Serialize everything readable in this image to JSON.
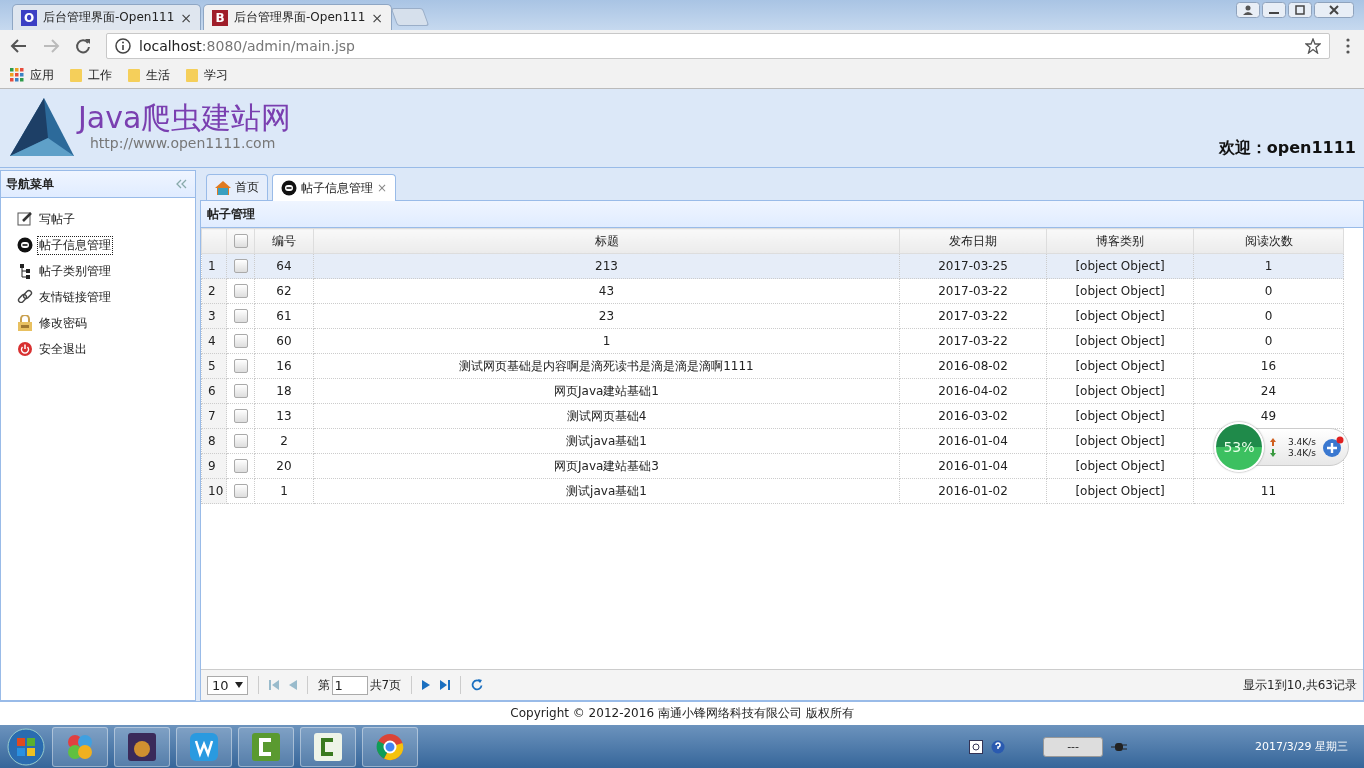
{
  "browser": {
    "tabs": [
      {
        "favicon": "O",
        "color": "#3b3fc4",
        "title": "后台管理界面-Open111",
        "close": "×",
        "selected": false
      },
      {
        "favicon": "B",
        "color": "#a01e2a",
        "title": "后台管理界面-Open111",
        "close": "×",
        "selected": true
      }
    ],
    "address": {
      "host": "localhost",
      "path": ":8080/admin/main.jsp"
    },
    "bookmarks": [
      {
        "kind": "apps",
        "label": "应用"
      },
      {
        "kind": "folder",
        "label": "工作"
      },
      {
        "kind": "folder",
        "label": "生活"
      },
      {
        "kind": "folder",
        "label": "学习"
      }
    ]
  },
  "header": {
    "logo_title": "Java爬虫建站网",
    "logo_url": "http://www.open1111.com",
    "welcome": "欢迎：open1111"
  },
  "sidebar": {
    "title": "导航菜单",
    "items": [
      {
        "kind": "edit",
        "label": "写帖子",
        "selected": false
      },
      {
        "kind": "blog",
        "label": "帖子信息管理",
        "selected": true
      },
      {
        "kind": "tree",
        "label": "帖子类别管理",
        "selected": false
      },
      {
        "kind": "link",
        "label": "友情链接管理",
        "selected": false
      },
      {
        "kind": "lock",
        "label": "修改密码",
        "selected": false
      },
      {
        "kind": "exit",
        "label": "安全退出",
        "selected": false
      }
    ]
  },
  "content_tabs": [
    {
      "kind": "home",
      "label": "首页",
      "selected": false,
      "closable": false
    },
    {
      "kind": "blog",
      "label": "帖子信息管理",
      "selected": true,
      "closable": true,
      "close": "×"
    }
  ],
  "panel": {
    "title": "帖子管理",
    "select_all_checked": false,
    "columns": [
      "编号",
      "标题",
      "发布日期",
      "博客类别",
      "阅读次数"
    ],
    "rows": [
      {
        "index": "1",
        "checked": false,
        "selected": true,
        "id": "64",
        "title": "213",
        "date": "2017-03-25",
        "category": "[object Object]",
        "reads": "1"
      },
      {
        "index": "2",
        "checked": false,
        "selected": false,
        "id": "62",
        "title": "43",
        "date": "2017-03-22",
        "category": "[object Object]",
        "reads": "0"
      },
      {
        "index": "3",
        "checked": false,
        "selected": false,
        "id": "61",
        "title": "23",
        "date": "2017-03-22",
        "category": "[object Object]",
        "reads": "0"
      },
      {
        "index": "4",
        "checked": false,
        "selected": false,
        "id": "60",
        "title": "1",
        "date": "2017-03-22",
        "category": "[object Object]",
        "reads": "0"
      },
      {
        "index": "5",
        "checked": false,
        "selected": false,
        "id": "16",
        "title": "测试网页基础是内容啊是滴死读书是滴是滴是滴啊1111",
        "date": "2016-08-02",
        "category": "[object Object]",
        "reads": "16"
      },
      {
        "index": "6",
        "checked": false,
        "selected": false,
        "id": "18",
        "title": "网页Java建站基础1",
        "date": "2016-04-02",
        "category": "[object Object]",
        "reads": "24"
      },
      {
        "index": "7",
        "checked": false,
        "selected": false,
        "id": "13",
        "title": "测试网页基础4",
        "date": "2016-03-02",
        "category": "[object Object]",
        "reads": "49"
      },
      {
        "index": "8",
        "checked": false,
        "selected": false,
        "id": "2",
        "title": "测试java基础1",
        "date": "2016-01-04",
        "category": "[object Object]"
      },
      {
        "index": "9",
        "checked": false,
        "selected": false,
        "id": "20",
        "title": "网页Java建站基础3",
        "date": "2016-01-04",
        "category": "[object Object]"
      },
      {
        "index": "10",
        "checked": false,
        "selected": false,
        "id": "1",
        "title": "测试java基础1",
        "date": "2016-01-02",
        "category": "[object Object]",
        "reads": "11"
      }
    ],
    "pager": {
      "page_size": "10",
      "page_prefix": "第",
      "page": "1",
      "page_suffix": "共7页",
      "summary": "显示1到10,共63记录"
    }
  },
  "footer": "Copyright © 2012-2016 南通小锋网络科技有限公司 版权所有",
  "speed_widget": {
    "percent": "53%",
    "up": "3.4K/s",
    "down": "3.4K/s"
  },
  "taskbar": {
    "apps": [
      {
        "kind": "balls"
      },
      {
        "kind": "ide"
      },
      {
        "kind": "wps"
      },
      {
        "kind": "camtasia"
      },
      {
        "kind": "camtasia_dark"
      },
      {
        "kind": "chrome"
      }
    ],
    "battery": "---",
    "date": "2017/3/29 星期三"
  }
}
